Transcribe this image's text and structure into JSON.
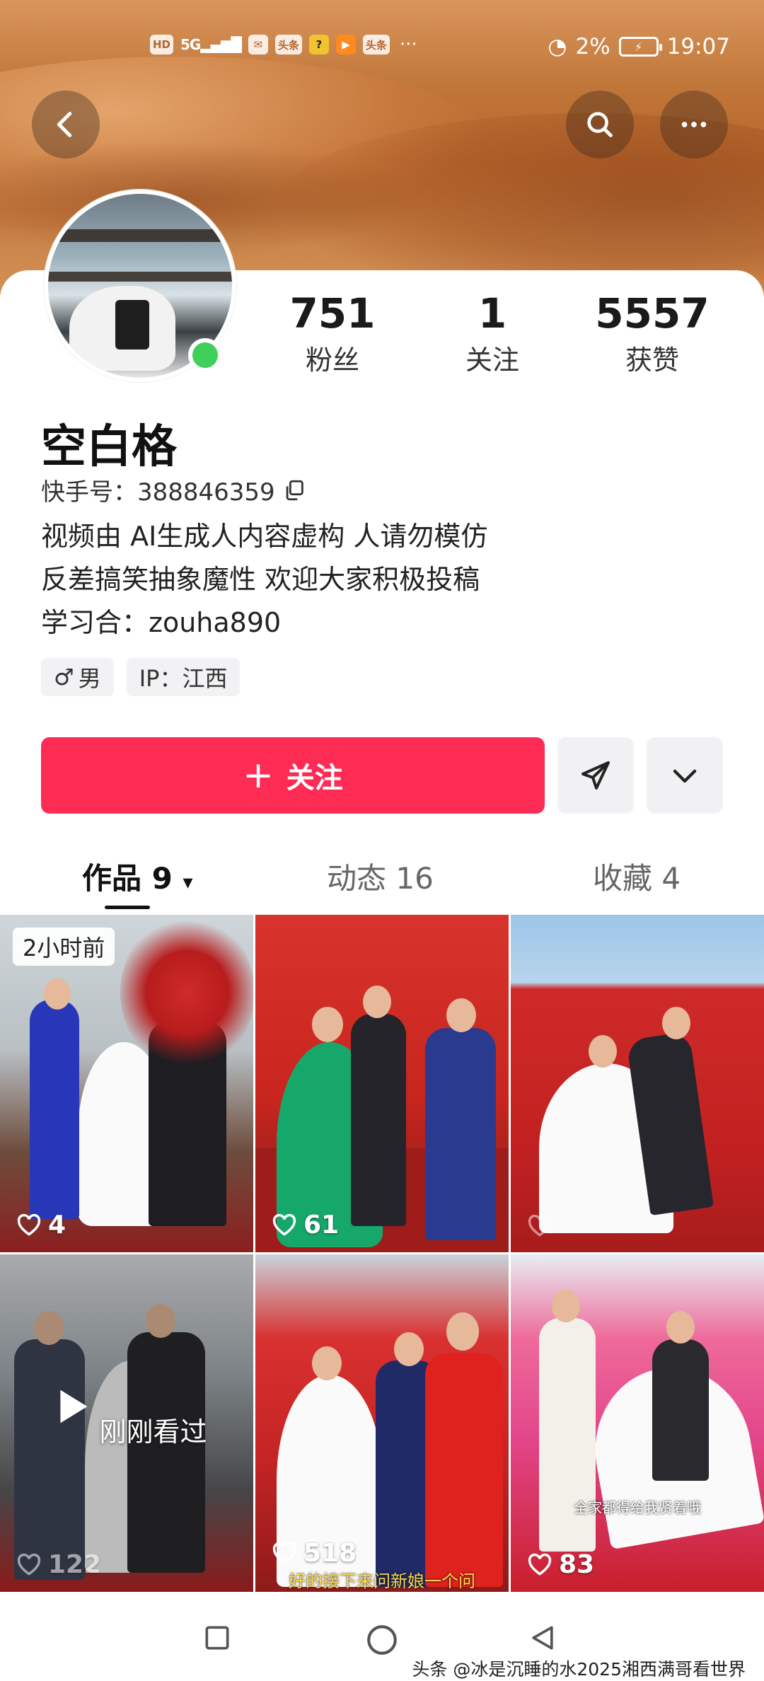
{
  "status_bar": {
    "left_icons": [
      "HD",
      "5G",
      "头条",
      "头条"
    ],
    "more": "···",
    "battery": "2%",
    "time": "19:07"
  },
  "header": {
    "back_icon": "chevron-left-icon",
    "search_icon": "search-icon",
    "more_icon": "more-dots-icon"
  },
  "profile": {
    "stats": [
      {
        "value": "751",
        "label": "粉丝"
      },
      {
        "value": "1",
        "label": "关注"
      },
      {
        "value": "5557",
        "label": "获赞"
      }
    ],
    "nickname": "空白格",
    "uid": "快手号：388846359",
    "bio": [
      "视频由 AI生成人内容虚构 人请勿模仿",
      "反差搞笑抽象魔性 欢迎大家积极投稿",
      "学习合：zouha890"
    ],
    "tags": [
      {
        "icon": "male-icon",
        "label": "男"
      },
      {
        "label": "IP：江西"
      }
    ]
  },
  "actions": {
    "follow_label": "关注",
    "send_icon": "send-icon",
    "dropdown_icon": "chevron-down-icon"
  },
  "tabs": [
    {
      "label": "作品 9"
    },
    {
      "label": "动态 16"
    },
    {
      "label": "收藏 4"
    }
  ],
  "videos": [
    {
      "likes": "4",
      "badge": "2小时前"
    },
    {
      "likes": "61"
    },
    {
      "likes": ""
    },
    {
      "likes": "122",
      "overlay": "刚刚看过"
    },
    {
      "likes": "518",
      "caption": "好的接下来问新娘一个问"
    },
    {
      "likes": "83",
      "caption": "全家都得给我贤着哦"
    }
  ],
  "watermark": "头条 @冰是沉睡的水2025湘西满哥看世界",
  "colors": {
    "accent": "#fe2c55",
    "online": "#3fcf5b"
  }
}
